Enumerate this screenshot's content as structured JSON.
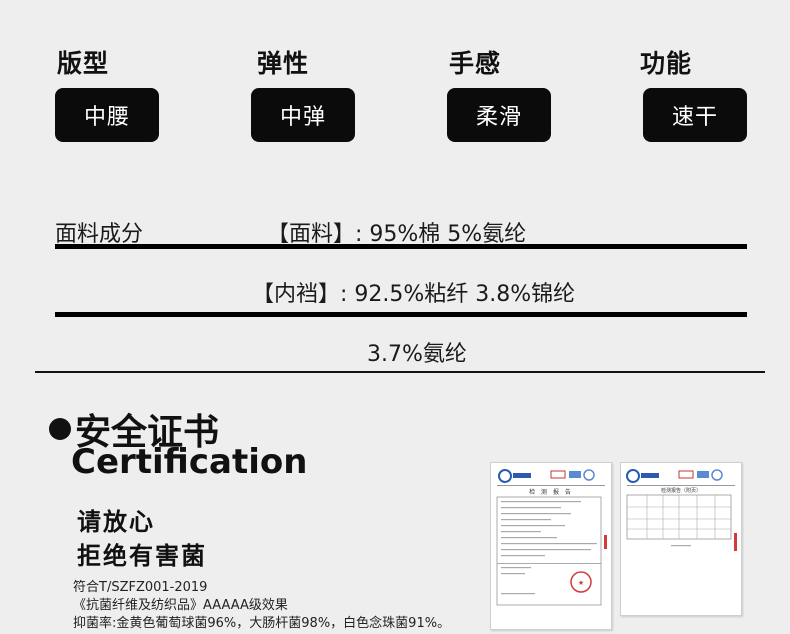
{
  "attributes": [
    {
      "label": "版型",
      "value": "中腰"
    },
    {
      "label": "弹性",
      "value": "中弹"
    },
    {
      "label": "手感",
      "value": "柔滑"
    },
    {
      "label": "功能",
      "value": "速干"
    }
  ],
  "fabric": {
    "heading": "面料成分",
    "line1": "【面料】: 95%棉  5%氨纶",
    "line2": "【内裆】:  92.5%粘纤  3.8%锦纶",
    "line3": "3.7%氨纶"
  },
  "certification": {
    "title": "安全证书",
    "title_en": "Certification",
    "sub1": "请放心",
    "sub2": "拒绝有害菌",
    "note1": "符合T/SZFZ001-2019",
    "note2": "《抗菌纤维及纺织品》AAAAA级效果",
    "note3": "抑菌率:金黄色葡萄球菌96%，大肠杆菌98%，白色念珠菌91%。"
  },
  "documents": [
    {
      "title": "检 测 报 告"
    },
    {
      "title": "检测报告（附页）"
    }
  ],
  "colors": {
    "badge_bg": "#0b0b0b",
    "page_bg": "#eeeeee",
    "stamp_red": "#d33a3a"
  }
}
